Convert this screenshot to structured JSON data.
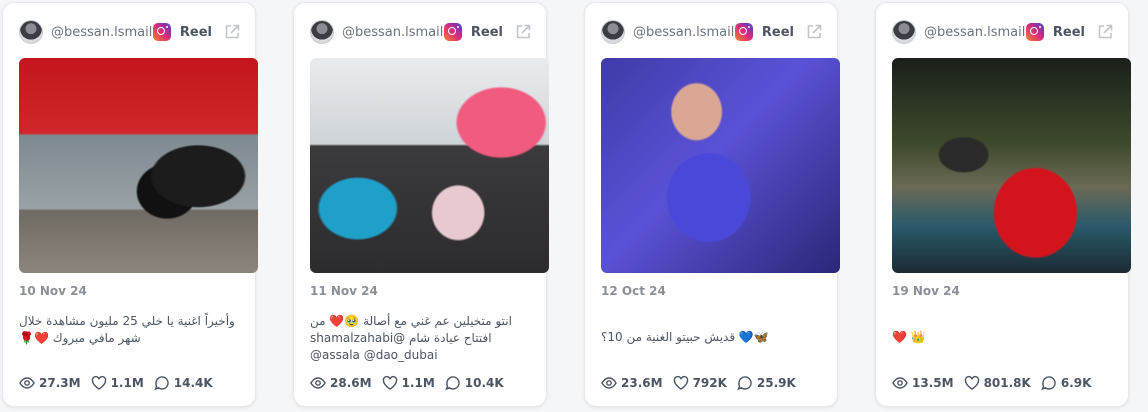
{
  "posts": [
    {
      "username": "@bessan.lsmail",
      "type_label": "Reel",
      "date": "10 Nov 24",
      "caption": "وأخيراً اغنية يا خلي 25 مليون مشاهدة خلال شهر مافي مبروك ❤️🌹",
      "views": "27.3M",
      "likes": "1.1M",
      "comments": "14.4K"
    },
    {
      "username": "@bessan.lsmail",
      "type_label": "Reel",
      "date": "11 Nov 24",
      "caption": "انتو متخيلين عم غني مع أصالة 🥹❤️ من افتتاح عيادة شام @shamalzahabi @assala @dao_dubai",
      "views": "28.6M",
      "likes": "1.1M",
      "comments": "10.4K"
    },
    {
      "username": "@bessan.lsmail",
      "type_label": "Reel",
      "date": "12 Oct 24",
      "caption": "🦋💙 قديش حبيتو الغنية من 10؟",
      "views": "23.6M",
      "likes": "792K",
      "comments": "25.9K"
    },
    {
      "username": "@bessan.lsmail",
      "type_label": "Reel",
      "date": "19 Nov 24",
      "caption": "❤️ 👑",
      "views": "13.5M",
      "likes": "801.8K",
      "comments": "6.9K"
    }
  ]
}
